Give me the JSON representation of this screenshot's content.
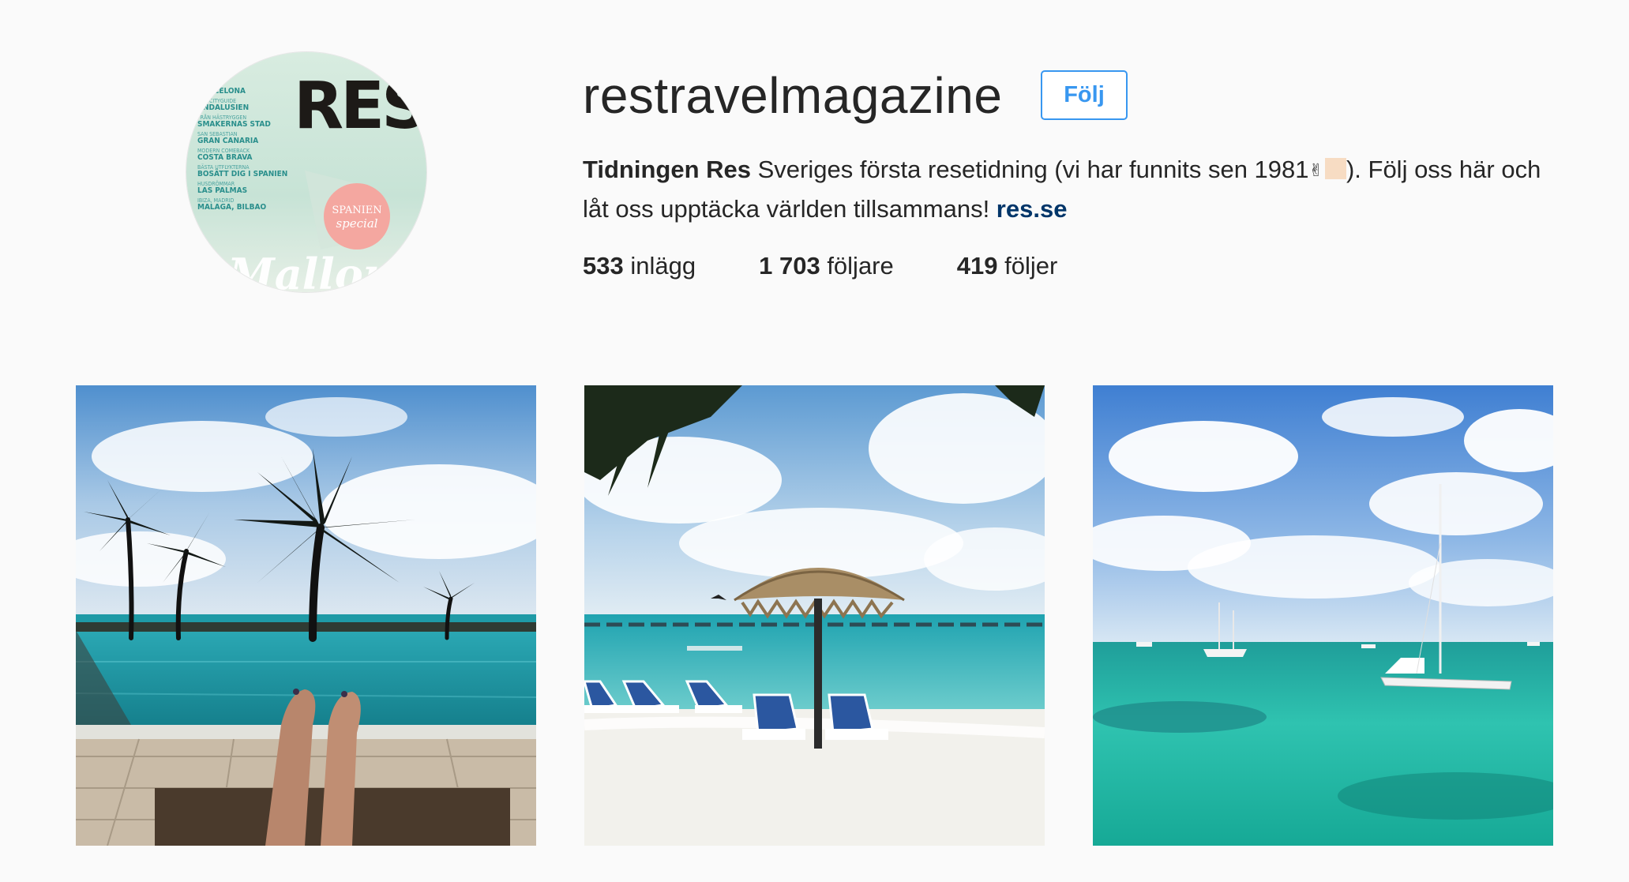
{
  "profile": {
    "username": "restravelmagazine",
    "follow_label": "Följ",
    "bio": {
      "name": "Tidningen Res",
      "text_before": " Sveriges första resetidning (vi har funnits sen 1981",
      "emoji": "✌",
      "text_after": "). Följ oss här och låt oss upptäcka världen tillsammans! ",
      "link": "res.se"
    },
    "stats": {
      "posts_count": "533",
      "posts_label": "inlägg",
      "followers_count": "1 703",
      "followers_label": "följare",
      "following_count": "419",
      "following_label": "följer"
    }
  },
  "avatar": {
    "logo": "RES",
    "cover_lines": [
      "BARCELONA",
      "FÖR CITYGUIDE",
      "ANDALUSIEN",
      "FRÅN HÄSTRYGGEN",
      "SMAKERNAS STAD",
      "SAN SEBASTIAN",
      "GRAN CANARIA",
      "MODERN COMEBACK",
      "COSTA BRAVA",
      "BÄSTA UTFLYKTERNA",
      "BOSÄTT DIG I SPANIEN",
      "HUSDRÖMMAR",
      "LAS PALMAS",
      "IBIZA, MADRID",
      "MALAGA, BILBAO"
    ],
    "badge_line1": "SPANIEN",
    "badge_line2": "special",
    "script_word": "Mallorca"
  },
  "posts": [
    {
      "subject": "infinity pool with palm trees and feet on sun lounger"
    },
    {
      "subject": "beach with thatched parasol and blue sun loungers"
    },
    {
      "subject": "turquoise sea with sailboat and catamaran"
    }
  ],
  "colors": {
    "background": "#fafafa",
    "text": "#262626",
    "follow_blue": "#3897f0",
    "link_blue": "#003569",
    "skin_tone": "#f7dcc3"
  }
}
